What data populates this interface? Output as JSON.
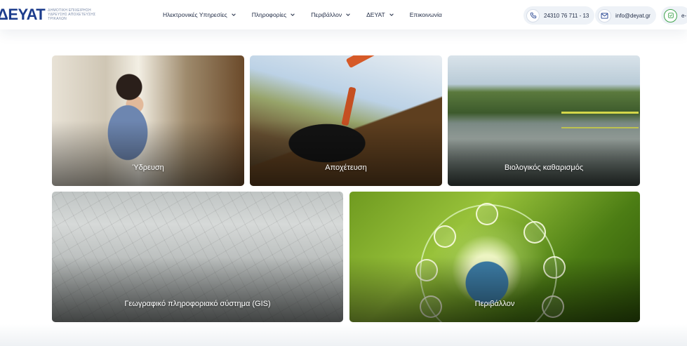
{
  "header": {
    "logo_text": "ΔΕΥΑΤ",
    "logo_subtitle_lines": [
      "ΔΗΜΟΤΙΚΗ ΕΠΙΧΕΙΡΗΣΗ",
      "ΥΔΡΕΥΣΗΣ ΑΠΟΧΕΤΕΥΣΗΣ",
      "ΤΡΙΚΑΛΩΝ"
    ],
    "nav": [
      {
        "label": "Ηλεκτρονικές Υπηρεσίες",
        "icon": "chevron-down-icon"
      },
      {
        "label": "Πληροφορίες",
        "icon": "chevron-down-icon"
      },
      {
        "label": "Περιβάλλον",
        "icon": "chevron-down-icon"
      },
      {
        "label": "ΔΕΥΑΤ",
        "icon": "chevron-down-icon"
      },
      {
        "label": "Επικοινωνία"
      }
    ],
    "phone": "24310 76 711 - 13",
    "email": "info@deyat.gr",
    "eservices_label": "e-"
  },
  "cards": [
    {
      "title": "Ύδρευση"
    },
    {
      "title": "Αποχέτευση"
    },
    {
      "title": "Βιολογικός καθαρισμός"
    },
    {
      "title": "Γεωγραφικό πληροφοριακό σύστημα (GIS)"
    },
    {
      "title": "Περιβάλλον"
    }
  ],
  "colors": {
    "brand": "#1c3c8c",
    "pill_bg": "#eef2f7",
    "eservice_accent": "#3fa34d"
  }
}
